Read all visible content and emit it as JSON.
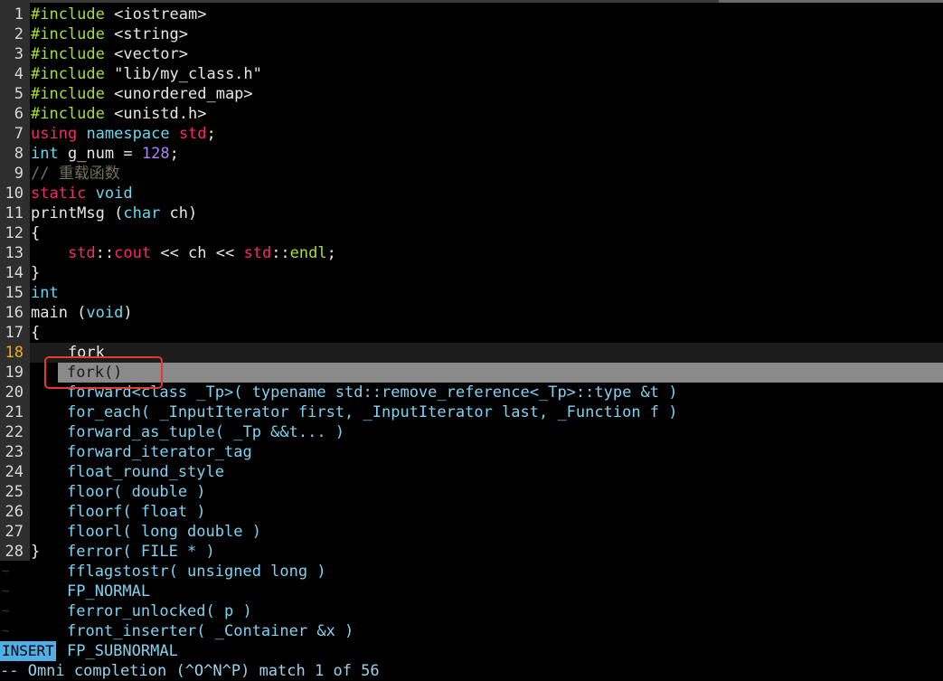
{
  "editor": {
    "lines": [
      {
        "n": "1",
        "segs": [
          {
            "t": "#include",
            "c": "kw-inc"
          },
          {
            "t": " <iostream>",
            "c": "plain"
          }
        ]
      },
      {
        "n": "2",
        "segs": [
          {
            "t": "#include",
            "c": "kw-inc"
          },
          {
            "t": " <string>",
            "c": "plain"
          }
        ]
      },
      {
        "n": "3",
        "segs": [
          {
            "t": "#include",
            "c": "kw-inc"
          },
          {
            "t": " <vector>",
            "c": "plain"
          }
        ]
      },
      {
        "n": "4",
        "segs": [
          {
            "t": "#include",
            "c": "kw-inc"
          },
          {
            "t": " \"lib/my_class.h\"",
            "c": "plain"
          }
        ]
      },
      {
        "n": "5",
        "segs": [
          {
            "t": "#include",
            "c": "kw-inc"
          },
          {
            "t": " <unordered_map>",
            "c": "plain"
          }
        ]
      },
      {
        "n": "6",
        "segs": [
          {
            "t": "#include",
            "c": "kw-inc"
          },
          {
            "t": " <unistd.h>",
            "c": "plain"
          }
        ]
      },
      {
        "n": "7",
        "segs": [
          {
            "t": "using",
            "c": "kw-pink"
          },
          {
            "t": " ",
            "c": "plain"
          },
          {
            "t": "namespace",
            "c": "kw-type"
          },
          {
            "t": " ",
            "c": "plain"
          },
          {
            "t": "std",
            "c": "kw-pink"
          },
          {
            "t": ";",
            "c": "plain"
          }
        ]
      },
      {
        "n": "8",
        "segs": [
          {
            "t": "int",
            "c": "kw-type"
          },
          {
            "t": " g_num = ",
            "c": "plain"
          },
          {
            "t": "128",
            "c": "kw-num"
          },
          {
            "t": ";",
            "c": "plain"
          }
        ]
      },
      {
        "n": "9",
        "segs": [
          {
            "t": "// 重载函数",
            "c": "kw-comment"
          }
        ]
      },
      {
        "n": "10",
        "segs": [
          {
            "t": "static",
            "c": "kw-pink"
          },
          {
            "t": " ",
            "c": "plain"
          },
          {
            "t": "void",
            "c": "kw-type"
          }
        ]
      },
      {
        "n": "11",
        "segs": [
          {
            "t": "printMsg (",
            "c": "plain"
          },
          {
            "t": "char",
            "c": "kw-type"
          },
          {
            "t": " ch)",
            "c": "plain"
          }
        ]
      },
      {
        "n": "12",
        "segs": [
          {
            "t": "{",
            "c": "plain"
          }
        ]
      },
      {
        "n": "13",
        "segs": [
          {
            "t": "    ",
            "c": "plain"
          },
          {
            "t": "std",
            "c": "kw-std"
          },
          {
            "t": "::",
            "c": "plain"
          },
          {
            "t": "cout",
            "c": "kw-std"
          },
          {
            "t": " << ch << ",
            "c": "plain"
          },
          {
            "t": "std",
            "c": "kw-std"
          },
          {
            "t": "::",
            "c": "plain"
          },
          {
            "t": "endl",
            "c": "kw-endl"
          },
          {
            "t": ";",
            "c": "plain"
          }
        ]
      },
      {
        "n": "14",
        "segs": [
          {
            "t": "}",
            "c": "plain"
          }
        ]
      },
      {
        "n": "15",
        "segs": [
          {
            "t": "int",
            "c": "kw-type"
          }
        ]
      },
      {
        "n": "16",
        "segs": [
          {
            "t": "main (",
            "c": "plain"
          },
          {
            "t": "void",
            "c": "kw-type"
          },
          {
            "t": ")",
            "c": "plain"
          }
        ]
      },
      {
        "n": "17",
        "segs": [
          {
            "t": "{",
            "c": "plain"
          }
        ]
      },
      {
        "n": "18",
        "segs": [
          {
            "t": "    fork",
            "c": "plain"
          }
        ],
        "current": true
      },
      {
        "n": "19",
        "segs": []
      },
      {
        "n": "20",
        "segs": []
      },
      {
        "n": "21",
        "segs": []
      },
      {
        "n": "22",
        "segs": []
      },
      {
        "n": "23",
        "segs": []
      },
      {
        "n": "24",
        "segs": []
      },
      {
        "n": "25",
        "segs": []
      },
      {
        "n": "26",
        "segs": []
      },
      {
        "n": "27",
        "segs": []
      },
      {
        "n": "28",
        "segs": [
          {
            "t": "}",
            "c": "plain"
          }
        ]
      }
    ],
    "tilde_char": "~"
  },
  "completion": {
    "items": [
      {
        "label": "fork()",
        "selected": true
      },
      {
        "label": "forward<class _Tp>( typename std::remove_reference<_Tp>::type &t )"
      },
      {
        "label": "for_each( _InputIterator first, _InputIterator last, _Function f )"
      },
      {
        "label": "forward_as_tuple( _Tp &&t... )"
      },
      {
        "label": "forward_iterator_tag"
      },
      {
        "label": "float_round_style"
      },
      {
        "label": "floor( double )"
      },
      {
        "label": "floorf( float )"
      },
      {
        "label": "floorl( long double )"
      },
      {
        "label": "ferror( FILE * )"
      },
      {
        "label": "fflagstostr( unsigned long )"
      },
      {
        "label": "FP_NORMAL"
      },
      {
        "label": "ferror_unlocked( p )"
      },
      {
        "label": "front_inserter( _Container &x )"
      },
      {
        "label": "FP_SUBNORMAL"
      }
    ]
  },
  "statusbar": {
    "mode": "INSERT",
    "message": "-- Omni completion (^O^N^P) match 1 of 56"
  },
  "colors": {
    "highlight_box": "#e8382e",
    "mode_bg": "#4fb0e8"
  }
}
